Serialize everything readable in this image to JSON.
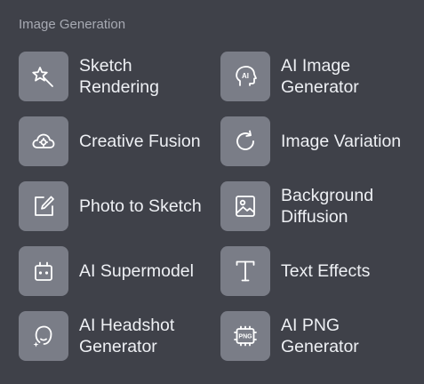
{
  "section": {
    "title": "Image Generation"
  },
  "tools": [
    {
      "label_line1": "Sketch",
      "label_line2": "Rendering",
      "icon": "magic-wand-icon"
    },
    {
      "label_line1": "AI Image",
      "label_line2": "Generator",
      "icon": "ai-head-icon"
    },
    {
      "label_line1": "Creative Fusion",
      "label_line2": "",
      "icon": "cloud-gear-icon"
    },
    {
      "label_line1": "Image Variation",
      "label_line2": "",
      "icon": "refresh-icon"
    },
    {
      "label_line1": "Photo to Sketch",
      "label_line2": "",
      "icon": "edit-square-icon"
    },
    {
      "label_line1": "Background",
      "label_line2": "Diffusion",
      "icon": "image-icon"
    },
    {
      "label_line1": "AI Supermodel",
      "label_line2": "",
      "icon": "robot-icon"
    },
    {
      "label_line1": "Text Effects",
      "label_line2": "",
      "icon": "text-t-icon"
    },
    {
      "label_line1": "AI Headshot",
      "label_line2": "Generator",
      "icon": "face-sparkle-icon"
    },
    {
      "label_line1": "AI PNG",
      "label_line2": "Generator",
      "icon": "png-badge-icon"
    }
  ],
  "icon_text": {
    "ai": "AI",
    "png": "PNG"
  },
  "colors": {
    "background": "#3f4149",
    "tile": "#7a7d87",
    "text": "#eef0f4",
    "muted": "#a7aab3"
  }
}
